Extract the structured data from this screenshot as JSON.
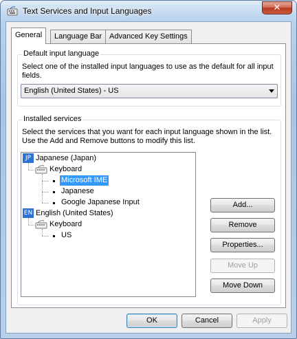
{
  "window": {
    "title": "Text Services and Input Languages",
    "close_glyph": "✕"
  },
  "tabs": [
    {
      "label": "General",
      "active": true
    },
    {
      "label": "Language Bar",
      "active": false
    },
    {
      "label": "Advanced Key Settings",
      "active": false
    }
  ],
  "default_language": {
    "title": "Default input language",
    "description_line1": "Select one of the installed input languages to use as the default for all input",
    "description_line2": "fields.",
    "selected": "English (United States) - US"
  },
  "installed_services": {
    "title": "Installed services",
    "description_line1": "Select the services that you want for each input language shown in the list.",
    "description_line2": "Use the Add and Remove buttons to modify this list.",
    "languages": [
      {
        "badge": "JP",
        "name": "Japanese (Japan)",
        "category": "Keyboard",
        "items": [
          "Microsoft IME",
          "Japanese",
          "Google Japanese Input"
        ],
        "selected_index": 0
      },
      {
        "badge": "EN",
        "name": "English (United States)",
        "category": "Keyboard",
        "items": [
          "US"
        ]
      }
    ],
    "buttons": {
      "add": "Add...",
      "remove": "Remove",
      "properties": "Properties...",
      "move_up": "Move Up",
      "move_down": "Move Down"
    }
  },
  "footer": {
    "ok": "OK",
    "cancel": "Cancel",
    "apply": "Apply"
  },
  "colors": {
    "selection": "#3399ff",
    "badge": "#2b72d4",
    "titlebar": "#a9c5e6"
  }
}
